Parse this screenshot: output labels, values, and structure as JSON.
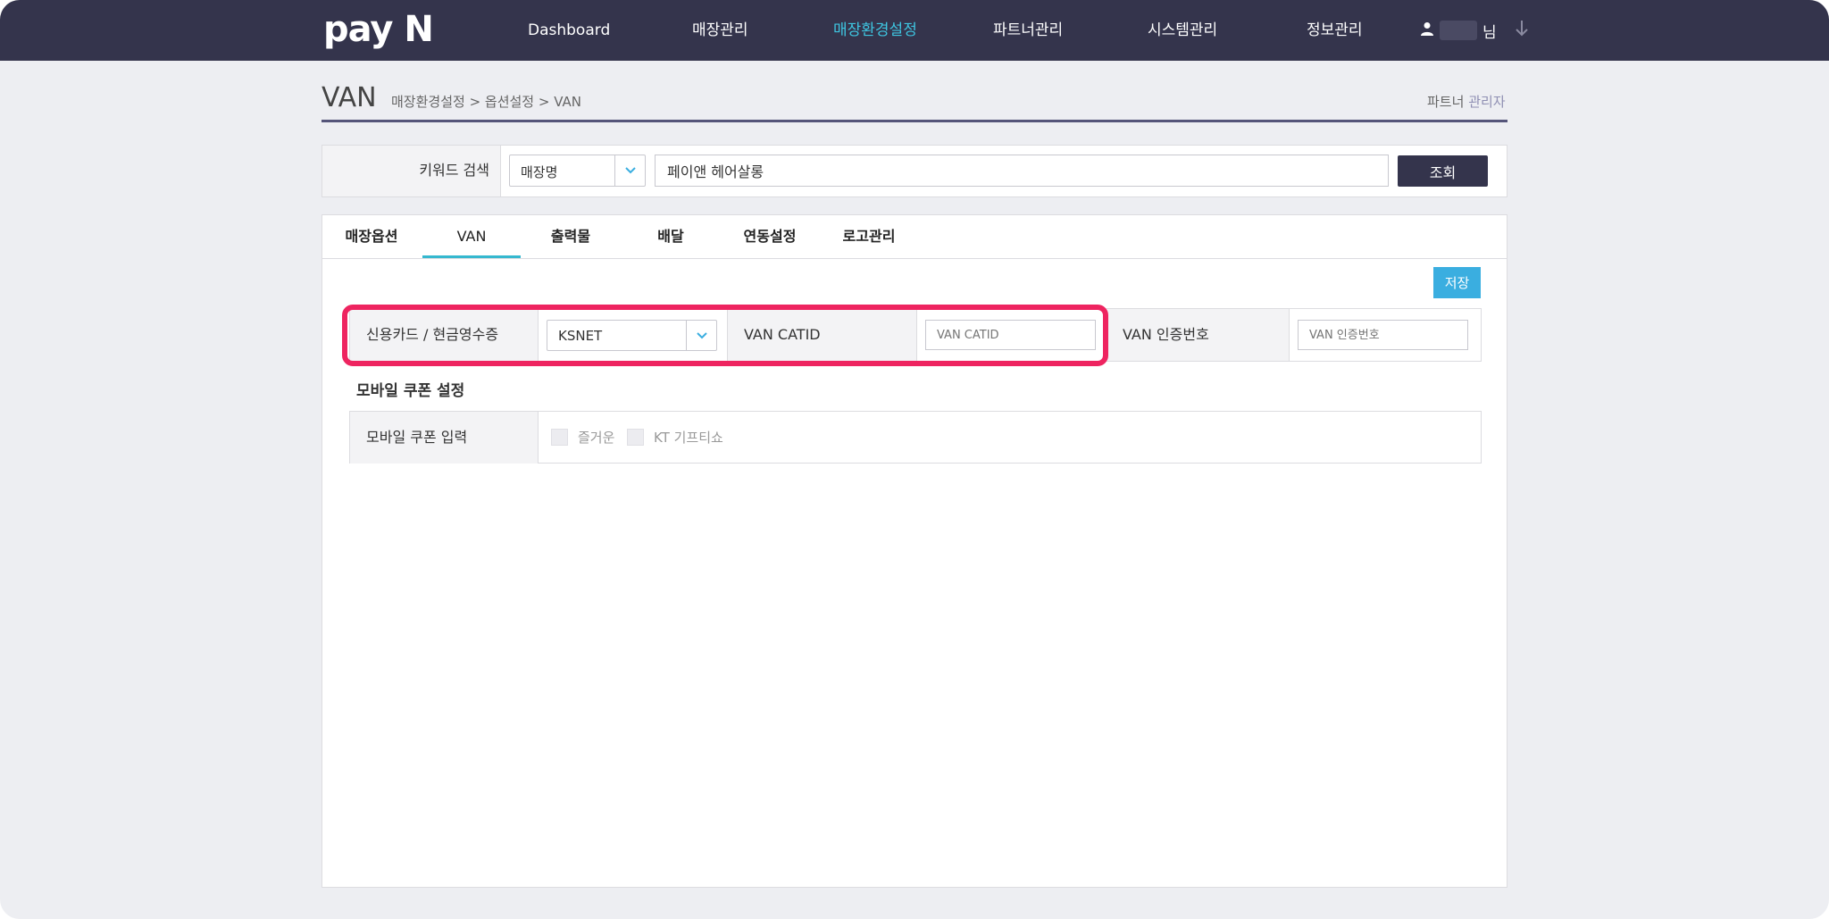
{
  "app": {
    "logo": "pay N"
  },
  "nav": {
    "items": [
      {
        "label": "Dashboard"
      },
      {
        "label": "매장관리"
      },
      {
        "label": "매장환경설정",
        "active": true
      },
      {
        "label": "파트너관리"
      },
      {
        "label": "시스템관리"
      },
      {
        "label": "정보관리"
      }
    ],
    "user_suffix": "님",
    "user_icon": "user-icon",
    "logout_icon": "arrow-down-icon"
  },
  "page": {
    "title": "VAN",
    "breadcrumb": "매장환경설정 > 옵션설정 > VAN",
    "role_prefix": "파트너",
    "role_accent": "관리자"
  },
  "search": {
    "label": "키워드 검색",
    "select_value": "매장명",
    "input_value": "페이앤 헤어살롱",
    "button_label": "조회"
  },
  "tabs": [
    {
      "label": "매장옵션"
    },
    {
      "label": "VAN",
      "active": true
    },
    {
      "label": "출력물"
    },
    {
      "label": "배달"
    },
    {
      "label": "연동설정"
    },
    {
      "label": "로고관리"
    }
  ],
  "form": {
    "save_label": "저장",
    "card_label": "신용카드 / 현금영수증",
    "card_select_value": "KSNET",
    "catid_label": "VAN CATID",
    "catid_placeholder": "VAN CATID",
    "auth_label": "VAN 인증번호",
    "auth_placeholder": "VAN 인증번호"
  },
  "coupon": {
    "section_title": "모바일 쿠폰 설정",
    "row_label": "모바일 쿠폰 입력",
    "options": [
      {
        "label": "즐거운",
        "checked": false
      },
      {
        "label": "KT 기프티쇼",
        "checked": false
      }
    ]
  },
  "colors": {
    "nav_bg": "#34344c",
    "nav_active": "#3ec5e0",
    "highlight": "#ee2460",
    "save_button": "#3aaee0",
    "tab_underline": "#35b8cf"
  }
}
